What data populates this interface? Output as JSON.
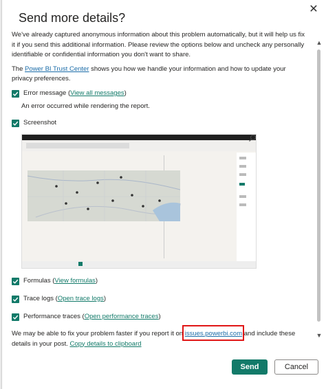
{
  "dialog": {
    "title": "Send more details?",
    "close_glyph": "✕",
    "intro_text": "We've already captured anonymous information about this problem automatically, but it will help us fix it if you send this additional information. Please review the options below and uncheck any personally identifiable or confidential information you don't want to share.",
    "trust_prefix": "The ",
    "trust_link": "Power BI Trust Center",
    "trust_suffix": " shows you how we handle your information and how to update your privacy preferences.",
    "error_label": "Error message",
    "error_link": "View all messages",
    "error_text": "An error occurred while rendering the report.",
    "screenshot_label": "Screenshot",
    "formulas_label": "Formulas",
    "formulas_link": "View formulas",
    "trace_label": "Trace logs",
    "trace_link": "Open trace logs",
    "perf_label": "Performance traces",
    "perf_link": "Open performance traces",
    "footer_prefix": "We may be able to fix your problem faster if you report it on ",
    "footer_link": "issues.powerbi.com",
    "footer_suffix": " and include these details in your post. ",
    "copy_link": "Copy details to clipboard",
    "send_label": "Send",
    "cancel_label": "Cancel"
  },
  "colors": {
    "accent": "#127a69",
    "highlight": "#e01515"
  },
  "icons": {
    "close": "close-icon",
    "check": "checkmark-icon",
    "search": "search-icon"
  }
}
